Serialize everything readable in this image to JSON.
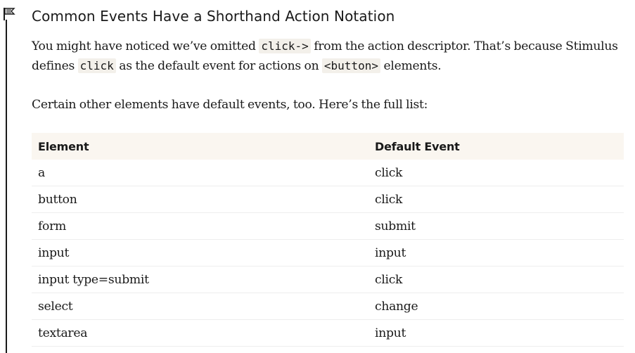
{
  "heading": "Common Events Have a Shorthand Action Notation",
  "paragraph1": {
    "t1": "You might have noticed we’ve omitted ",
    "code1": "click->",
    "t2": " from the action descriptor. That’s because Stimulus defines ",
    "code2": "click",
    "t3": " as the default event for actions on ",
    "code3": "<button>",
    "t4": " elements."
  },
  "paragraph2": "Certain other elements have default events, too. Here’s the full list:",
  "table": {
    "headers": [
      "Element",
      "Default Event"
    ],
    "rows": [
      [
        "a",
        "click"
      ],
      [
        "button",
        "click"
      ],
      [
        "form",
        "submit"
      ],
      [
        "input",
        "input"
      ],
      [
        "input type=submit",
        "click"
      ],
      [
        "select",
        "change"
      ],
      [
        "textarea",
        "input"
      ]
    ]
  },
  "icons": {
    "heading_marker": "flag-icon"
  }
}
